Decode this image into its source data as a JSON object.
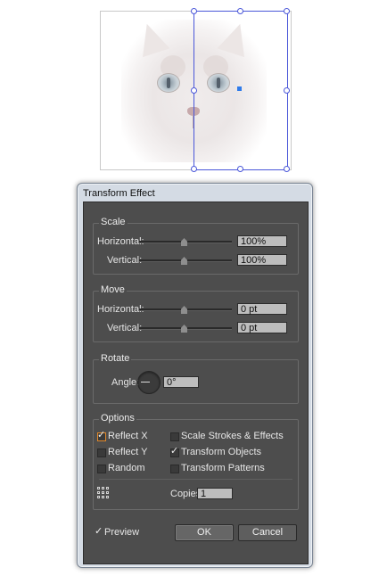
{
  "dialog": {
    "title": "Transform Effect",
    "scale": {
      "legend": "Scale",
      "horizontal_label": "Horizontal:",
      "horizontal_value": "100%",
      "horizontal_slider": 0.5,
      "vertical_label": "Vertical:",
      "vertical_value": "100%",
      "vertical_slider": 0.5
    },
    "move": {
      "legend": "Move",
      "horizontal_label": "Horizontal:",
      "horizontal_value": "0 pt",
      "horizontal_slider": 0.5,
      "vertical_label": "Vertical:",
      "vertical_value": "0 pt",
      "vertical_slider": 0.5
    },
    "rotate": {
      "legend": "Rotate",
      "angle_label": "Angle:",
      "angle_value": "0°"
    },
    "options": {
      "legend": "Options",
      "checkboxes": [
        {
          "label": "Reflect X",
          "checked": true
        },
        {
          "label": "Reflect Y",
          "checked": false
        },
        {
          "label": "Random",
          "checked": false
        },
        {
          "label": "Scale Strokes & Effects",
          "checked": false
        },
        {
          "label": "Transform Objects",
          "checked": true
        },
        {
          "label": "Transform Patterns",
          "checked": false
        }
      ],
      "copies_label": "Copies",
      "copies_value": "1",
      "reference_point_icon": "reference-point-grid-icon"
    },
    "preview": {
      "label": "Preview",
      "checked": true
    },
    "ok_label": "OK",
    "cancel_label": "Cancel"
  },
  "canvas": {
    "selection_color": "#4a57d9",
    "anchor_color": "#2f7bea"
  }
}
